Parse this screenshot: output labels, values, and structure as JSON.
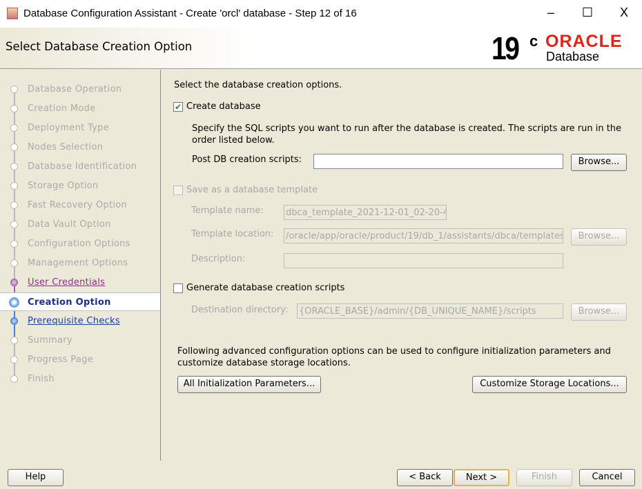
{
  "window": {
    "title": "Database Configuration Assistant - Create 'orcl' database - Step 12 of 16",
    "minimize": "–",
    "maximize": "☐",
    "close": "X"
  },
  "header": {
    "title": "Select Database Creation Option",
    "logo_version": "19",
    "logo_c": "c",
    "logo_brand": "ORACLE",
    "logo_product": "Database"
  },
  "sidebar": {
    "steps": [
      {
        "label": "Database Operation",
        "state": "done"
      },
      {
        "label": "Creation Mode",
        "state": "done"
      },
      {
        "label": "Deployment Type",
        "state": "done"
      },
      {
        "label": "Nodes Selection",
        "state": "done"
      },
      {
        "label": "Database Identification",
        "state": "done"
      },
      {
        "label": "Storage Option",
        "state": "done"
      },
      {
        "label": "Fast Recovery Option",
        "state": "done"
      },
      {
        "label": "Data Vault Option",
        "state": "done"
      },
      {
        "label": "Configuration Options",
        "state": "done"
      },
      {
        "label": "Management Options",
        "state": "done"
      },
      {
        "label": "User Credentials",
        "state": "visited"
      },
      {
        "label": "Creation Option",
        "state": "current"
      },
      {
        "label": "Prerequisite Checks",
        "state": "next"
      },
      {
        "label": "Summary",
        "state": "todo"
      },
      {
        "label": "Progress Page",
        "state": "todo"
      },
      {
        "label": "Finish",
        "state": "todo"
      }
    ]
  },
  "main": {
    "intro": "Select the database creation options.",
    "create_db": {
      "label": "Create database",
      "checked": true
    },
    "scripts_desc": "Specify the SQL scripts you want to run after the database is created. The scripts are run in the order listed below.",
    "post_scripts_label": "Post DB creation scripts:",
    "post_scripts_value": "",
    "browse": "Browse...",
    "save_template": {
      "label": "Save as a database template",
      "checked": false
    },
    "template_name_label": "Template name:",
    "template_name_value": "dbca_template_2021-12-01_02-20-4",
    "template_location_label": "Template location:",
    "template_location_value": "/oracle/app/oracle/product/19/db_1/assistants/dbca/templates",
    "description_label": "Description:",
    "description_value": "",
    "gen_scripts": {
      "label": "Generate database creation scripts",
      "checked": false
    },
    "dest_dir_label": "Destination directory:",
    "dest_dir_value": "{ORACLE_BASE}/admin/{DB_UNIQUE_NAME}/scripts",
    "advanced_desc": "Following advanced configuration options can be used to configure initialization parameters and customize database storage locations.",
    "init_params_btn": "All Initialization Parameters...",
    "storage_btn": "Customize Storage Locations..."
  },
  "footer": {
    "help": "Help",
    "back": "< Back",
    "next": "Next >",
    "finish": "Finish",
    "cancel": "Cancel"
  }
}
